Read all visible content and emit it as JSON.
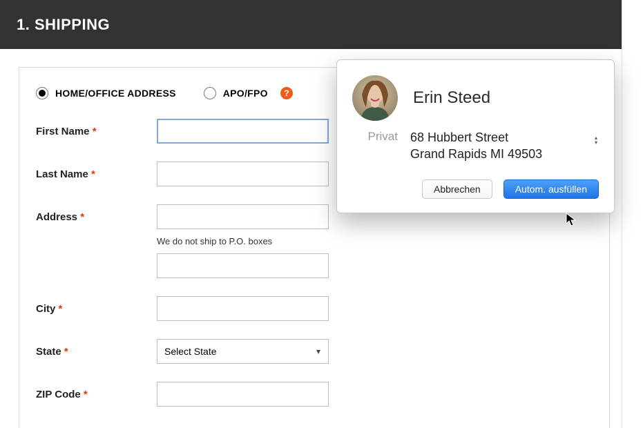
{
  "header": {
    "title": "1. SHIPPING"
  },
  "addressType": {
    "home_label": "HOME/OFFICE ADDRESS",
    "apo_label": "APO/FPO",
    "help_glyph": "?"
  },
  "fields": {
    "first_name_label": "First Name",
    "last_name_label": "Last Name",
    "address_label": "Address",
    "address_hint": "We do not ship to P.O. boxes",
    "city_label": "City",
    "state_label": "State",
    "state_placeholder": "Select State",
    "zip_label": "ZIP Code",
    "required_mark": "*"
  },
  "autofill": {
    "name": "Erin Steed",
    "type_label": "Privat",
    "line1": "68 Hubbert Street",
    "line2": "Grand Rapids MI 49503",
    "cancel_label": "Abbrechen",
    "fill_label": "Autom. ausfüllen"
  }
}
